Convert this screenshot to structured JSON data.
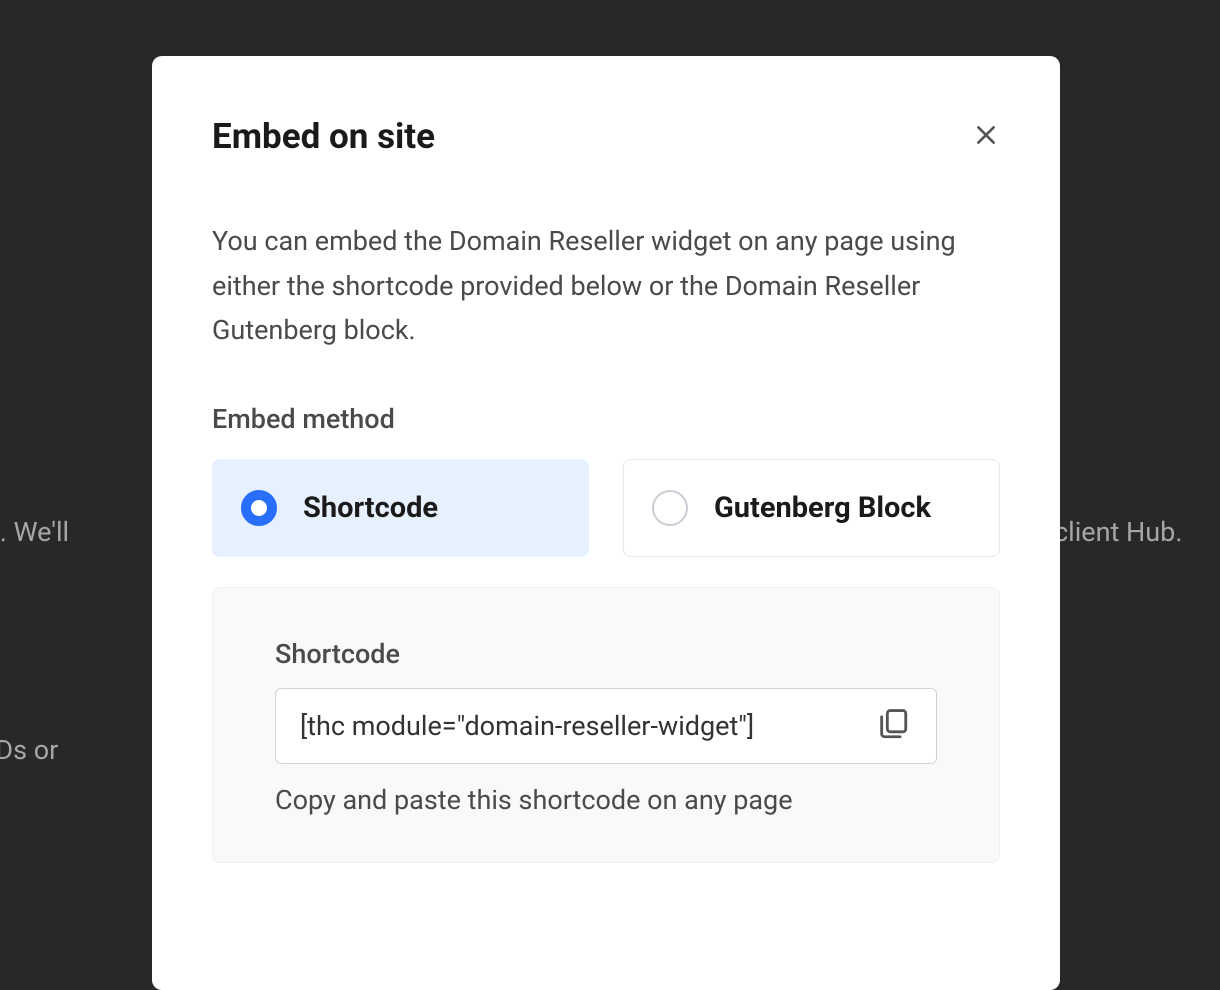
{
  "background": {
    "text_left_1": "nt Hub. We'll",
    "text_right_1": "client Hub.",
    "text_left_2": "ore TLDs or "
  },
  "modal": {
    "title": "Embed on site",
    "description": "You can embed the Domain Reseller widget on any page using either the shortcode provided below or the Domain Reseller Gutenberg block.",
    "embed_method_label": "Embed method",
    "options": {
      "shortcode": {
        "label": "Shortcode",
        "selected": true
      },
      "gutenberg": {
        "label": "Gutenberg Block",
        "selected": false
      }
    },
    "shortcode_panel": {
      "label": "Shortcode",
      "value": "[thc module=\"domain-reseller-widget\"]",
      "help": "Copy and paste this shortcode on any page"
    },
    "icons": {
      "close": "close-icon",
      "copy": "copy-icon"
    }
  }
}
